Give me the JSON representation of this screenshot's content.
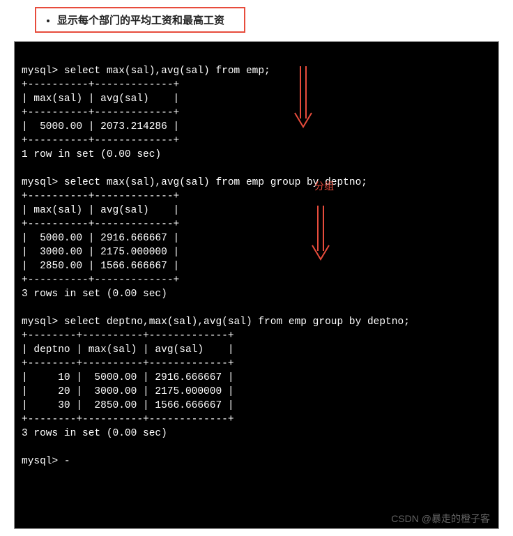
{
  "title": "显示每个部门的平均工资和最高工资",
  "annotation": "分组",
  "watermark": "CSDN @暴走的橙子客",
  "query1": {
    "prompt": "mysql> select max(sal),avg(sal) from emp;",
    "sep": "+----------+-------------+",
    "header": "| max(sal) | avg(sal)    |",
    "row1": "|  5000.00 | 2073.214286 |",
    "footer": "1 row in set (0.00 sec)"
  },
  "query2": {
    "prompt": "mysql> select max(sal),avg(sal) from emp group by deptno;",
    "sep": "+----------+-------------+",
    "header": "| max(sal) | avg(sal)    |",
    "row1": "|  5000.00 | 2916.666667 |",
    "row2": "|  3000.00 | 2175.000000 |",
    "row3": "|  2850.00 | 1566.666667 |",
    "footer": "3 rows in set (0.00 sec)"
  },
  "query3": {
    "prompt": "mysql> select deptno,max(sal),avg(sal) from emp group by deptno;",
    "sep": "+--------+----------+-------------+",
    "header": "| deptno | max(sal) | avg(sal)    |",
    "row1": "|     10 |  5000.00 | 2916.666667 |",
    "row2": "|     20 |  3000.00 | 2175.000000 |",
    "row3": "|     30 |  2850.00 | 1566.666667 |",
    "footer": "3 rows in set (0.00 sec)"
  },
  "final_prompt": "mysql> -"
}
